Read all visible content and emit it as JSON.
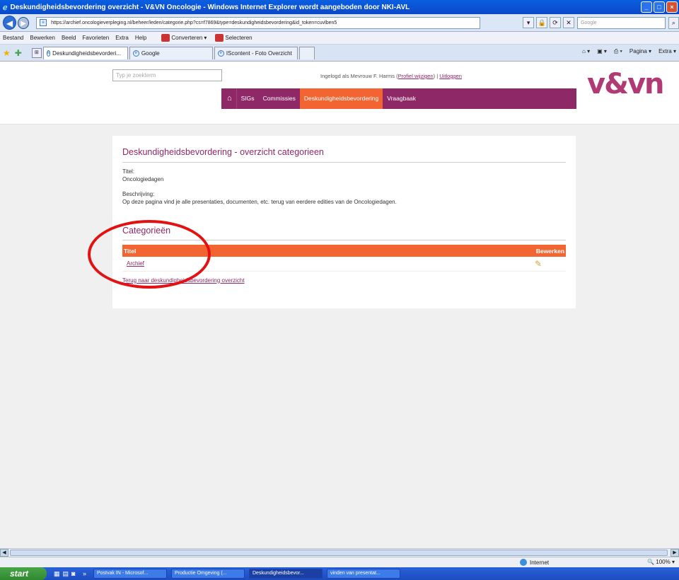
{
  "window": {
    "title": "Deskundigheidsbevordering overzicht - V&VN Oncologie - Windows Internet Explorer wordt aangeboden door NKI-AVL"
  },
  "address_bar": {
    "url": "https://archief.oncologieverpleging.nl/beheer/leden/categorie.php?cs=f7869&type=deskundigheidsbevordering&id_token=cuvlben5",
    "search_placeholder": "Google"
  },
  "menu": {
    "items": [
      "Bestand",
      "Bewerken",
      "Beeld",
      "Favorieten",
      "Extra",
      "Help"
    ],
    "convert_label": "Converteren",
    "select_label": "Selecteren"
  },
  "tabs": [
    {
      "label": "Deskundigheidsbevorderi...",
      "active": true
    },
    {
      "label": "Google",
      "active": false
    },
    {
      "label": "IScontent - Foto Overzicht",
      "active": false
    }
  ],
  "command_bar": {
    "page_label": "Pagina",
    "extra_label": "Extra"
  },
  "site": {
    "search_placeholder": "Typ je zoekterm",
    "login_prefix": "Ingelogd als Mevrouw F. Harms (",
    "profile_link": "Profiel wijzigen",
    "login_sep": ") | ",
    "logout_link": "Uitloggen",
    "logo_text": "v&vn",
    "nav": [
      {
        "label": "SIGs",
        "active": false
      },
      {
        "label": "Commissies",
        "active": false
      },
      {
        "label": "Deskundigheidsbevordering",
        "active": true
      },
      {
        "label": "Vraagbaak",
        "active": false
      }
    ]
  },
  "main": {
    "heading": "Deskundigheidsbevordering - overzicht categorieen",
    "title_label": "Titel:",
    "title_value": "Oncologiedagen",
    "desc_label": "Beschrijving:",
    "desc_value": "Op deze pagina vind je alle presentaties, documenten, etc. terug van eerdere edities van de Oncologiedagen.",
    "categories_heading": "Categorieën",
    "table": {
      "col_title": "Titel",
      "col_edit": "Bewerken",
      "rows": [
        {
          "title": "Archief"
        }
      ]
    },
    "back_link": "Terug naar deskundigheidsbevordering overzicht"
  },
  "status_bar": {
    "zone": "Internet",
    "zoom": "100%"
  },
  "taskbar": {
    "start_label": "start",
    "tasks": [
      {
        "label": "Postvak IN - Microsof...",
        "active": false
      },
      {
        "label": "Productie Omgeving (...",
        "active": false
      },
      {
        "label": "Deskundigheidsbevor...",
        "active": true
      },
      {
        "label": "vinden van presentat...",
        "active": false
      }
    ]
  },
  "colors": {
    "brand_purple": "#8e2866",
    "accent_orange": "#f26532",
    "annotation_red": "#e31212"
  }
}
